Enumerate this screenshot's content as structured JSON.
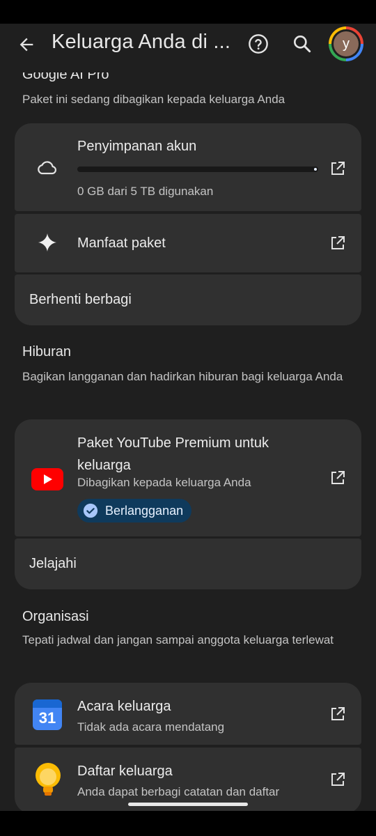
{
  "header": {
    "title": "Keluarga Anda di ...",
    "avatar_letter": "y"
  },
  "plan": {
    "title": "Google AI Pro",
    "desc": "Paket ini sedang dibagikan kepada keluarga Anda",
    "storage_title": "Penyimpanan akun",
    "storage_usage": "0 GB dari 5 TB digunakan",
    "storage_fraction": 0.0,
    "benefits_label": "Manfaat paket",
    "stop_sharing_label": "Berhenti berbagi"
  },
  "entertainment": {
    "title": "Hiburan",
    "desc": "Bagikan langganan dan hadirkan hiburan bagi keluarga Anda",
    "youtube_title": "Paket YouTube Premium untuk keluarga",
    "youtube_sub": "Dibagikan kepada keluarga Anda",
    "chip_label": "Berlangganan",
    "explore_label": "Jelajahi"
  },
  "organization": {
    "title": "Organisasi",
    "desc": "Tepati jadwal dan jangan sampai anggota keluarga terlewat",
    "events_title": "Acara keluarga",
    "events_sub": "Tidak ada acara mendatang",
    "calendar_day": "31",
    "list_title": "Daftar keluarga",
    "list_sub": "Anda dapat berbagi catatan dan daftar"
  },
  "colors": {
    "background": "#1f1f1f",
    "card": "#303030",
    "accent": "#a8c7fa",
    "youtube_red": "#ff0000",
    "chip_bg": "#0f3a5c"
  }
}
